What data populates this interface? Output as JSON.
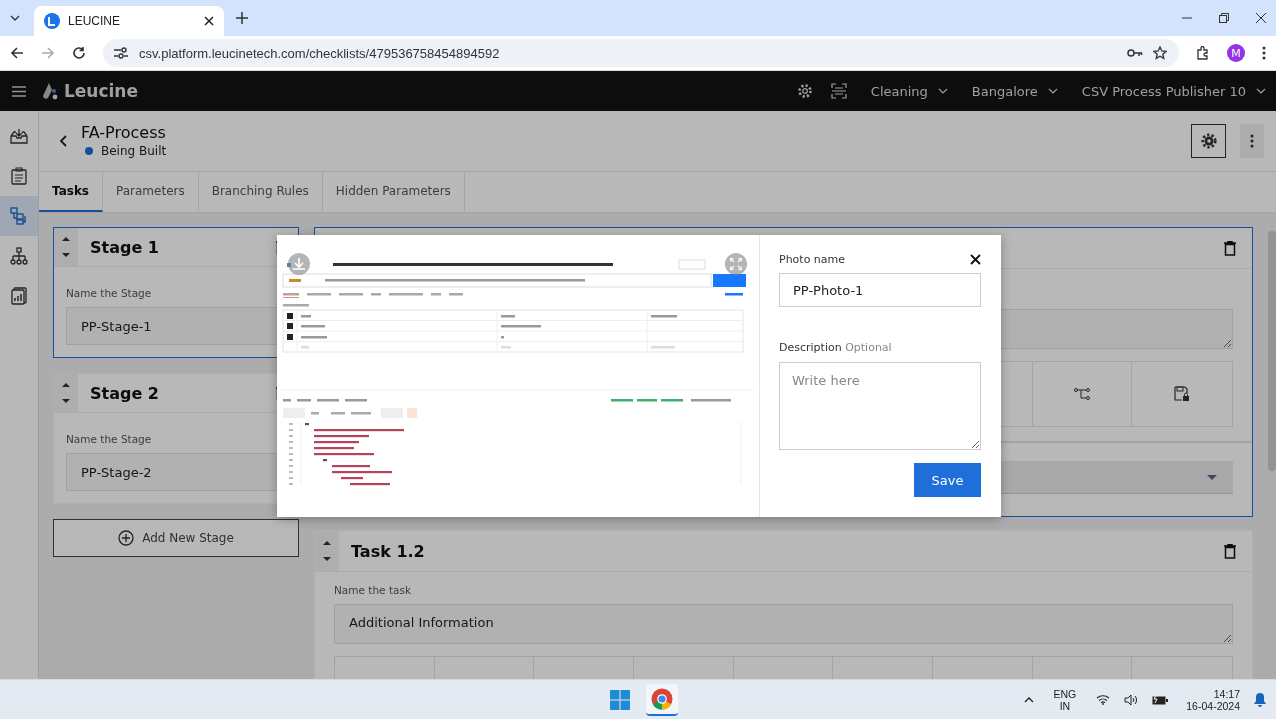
{
  "browser": {
    "tab_title": "LEUCINE",
    "url": "csv.platform.leucinetech.com/checklists/479536758454894592",
    "avatar_letter": "M"
  },
  "app_header": {
    "brand": "Leucine",
    "selectors": [
      "Cleaning",
      "Bangalore",
      "CSV Process Publisher 10"
    ]
  },
  "sidebar": {
    "items": [
      {
        "selected": false
      },
      {
        "selected": false
      },
      {
        "selected": true
      },
      {
        "selected": false
      },
      {
        "selected": false
      }
    ]
  },
  "process": {
    "title": "FA-Process",
    "status": "Being Built"
  },
  "tabs": [
    {
      "label": "Tasks",
      "selected": true
    },
    {
      "label": "Parameters",
      "selected": false
    },
    {
      "label": "Branching Rules",
      "selected": false
    },
    {
      "label": "Hidden Parameters",
      "selected": false
    }
  ],
  "stages": [
    {
      "title": "Stage 1",
      "field_label": "Name the Stage",
      "value": "PP-Stage-1",
      "selected": true
    },
    {
      "title": "Stage 2",
      "field_label": "Name the Stage",
      "value": "PP-Stage-2",
      "selected": false
    }
  ],
  "add_stage_button": "Add New Stage",
  "tasks": [
    {
      "selected": true
    },
    {
      "title": "Task 1.2",
      "field_label": "Name the task",
      "value": "Additional Information",
      "selected": false
    }
  ],
  "modal": {
    "photo_name_label": "Photo name",
    "photo_name_value": "PP-Photo-1",
    "description_label": "Description",
    "description_hint": "Optional",
    "description_placeholder": "Write here",
    "save_button": "Save"
  },
  "taskbar": {
    "language": "ENG",
    "region": "IN",
    "time": "14:17",
    "date": "16-04-2024"
  }
}
